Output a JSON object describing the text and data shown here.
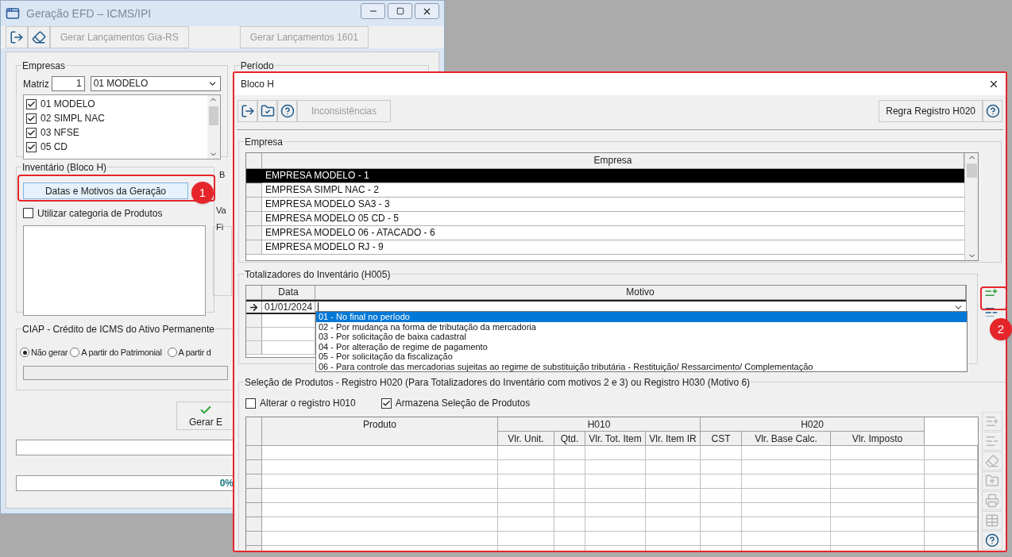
{
  "main_window": {
    "title": "Geração EFD – ICMS/IPI",
    "toolbar": [
      {
        "kind": "exit"
      },
      {
        "kind": "eraser"
      }
    ],
    "action_buttons": [
      {
        "label": "Gerar Lançamentos Gia-RS",
        "disabled": true
      },
      {
        "label": "Gerar Lançamentos 1601",
        "disabled": true
      }
    ]
  },
  "empresas": {
    "legend": "Empresas",
    "matriz_label": "Matriz",
    "matriz_value": "1",
    "select_value": "01 MODELO",
    "items": [
      {
        "label": "01 MODELO",
        "checked": true
      },
      {
        "label": "02 SIMPL NAC",
        "checked": true
      },
      {
        "label": "03 NFSE",
        "checked": true
      },
      {
        "label": "05 CD",
        "checked": true
      }
    ]
  },
  "periodo": {
    "legend": "Período"
  },
  "inventario": {
    "legend": "Inventário (Bloco H)",
    "button": "Datas e Motivos da Geração",
    "checkbox": {
      "label": "Utilizar categoria de Produtos",
      "checked": false
    }
  },
  "partial_labels": {
    "label_1": "B",
    "label_2": "Va",
    "group_legend": "Fi"
  },
  "ciap": {
    "legend": "CIAP - Crédito de ICMS do Ativo Permanente",
    "options": [
      {
        "label": "Não gerar",
        "selected": true
      },
      {
        "label": "A partir do Patrimonial",
        "selected": false
      },
      {
        "label": "A partir d",
        "selected": false
      }
    ]
  },
  "generate_button": "Gerar E",
  "progress": {
    "text": "0%",
    "level": 0
  },
  "annotations": [
    {
      "number": "1"
    },
    {
      "number": "2"
    }
  ],
  "dialog": {
    "title": "Bloco H",
    "toolbar": [
      {
        "kind": "exit"
      },
      {
        "kind": "folder-check"
      },
      {
        "kind": "help"
      }
    ],
    "inconsistencias": {
      "label": "Inconsistências",
      "disabled": true
    },
    "rule_button": "Regra Registro H020",
    "empresa": {
      "legend": "Empresa",
      "column": "Empresa",
      "rows": [
        {
          "name": "EMPRESA MODELO - 1",
          "selected": true
        },
        {
          "name": "EMPRESA SIMPL NAC - 2",
          "selected": false
        },
        {
          "name": "EMPRESA MODELO SA3 - 3",
          "selected": false
        },
        {
          "name": "EMPRESA MODELO 05 CD - 5",
          "selected": false
        },
        {
          "name": "EMPRESA MODELO 06 - ATACADO - 6",
          "selected": false
        },
        {
          "name": "EMPRESA MODELO RJ - 9",
          "selected": false
        }
      ]
    },
    "totalizadores": {
      "legend": "Totalizadores do Inventário (H005)",
      "columns": [
        "Data",
        "Motivo"
      ],
      "rows": [
        {
          "data": "01/01/2024",
          "current": true
        }
      ],
      "dropdown": [
        {
          "label": "01 - No final no período",
          "selected": true
        },
        {
          "label": "02 - Por mudança na forma de tributação da mercadoria",
          "selected": false
        },
        {
          "label": "03 - Por solicitação de baixa cadastral",
          "selected": false
        },
        {
          "label": "04 - Por alteração de regime de pagamento",
          "selected": false
        },
        {
          "label": "05 - Por solicitação da fiscalização",
          "selected": false
        },
        {
          "label": "06 - Para controle das mercadorias sujeitas ao regime de substituição tributária - Restituição/ Ressarcimento/ Complementação",
          "selected": false
        }
      ],
      "tools": [
        {
          "kind": "add-row",
          "disabled": false
        },
        {
          "kind": "remove-row",
          "disabled": false
        }
      ]
    },
    "selecao": {
      "legend": "Seleção de Produtos - Registro H020 (Para Totalizadores do Inventário com motivos 2 e 3) ou Registro H030 (Motivo 6)",
      "checkboxes": [
        {
          "label": "Alterar o registro H010",
          "checked": false
        },
        {
          "label": "Armazena Seleção de Produtos",
          "checked": true
        }
      ],
      "product_column": "Produto",
      "groups": [
        {
          "label": "H010",
          "columns": [
            "Vlr. Unit.",
            "Qtd.",
            "Vlr. Tot. Item",
            "Vlr. Item IR"
          ]
        },
        {
          "label": "H020",
          "columns": [
            "CST",
            "Vlr. Base Calc.",
            "Vlr. Imposto"
          ]
        }
      ],
      "tools": [
        {
          "kind": "add-row",
          "disabled": true
        },
        {
          "kind": "remove-row",
          "disabled": true
        },
        {
          "kind": "eraser",
          "disabled": true
        },
        {
          "kind": "upload",
          "disabled": true
        },
        {
          "kind": "print",
          "disabled": true
        },
        {
          "kind": "table",
          "disabled": true
        },
        {
          "kind": "help",
          "disabled": false
        }
      ]
    }
  }
}
